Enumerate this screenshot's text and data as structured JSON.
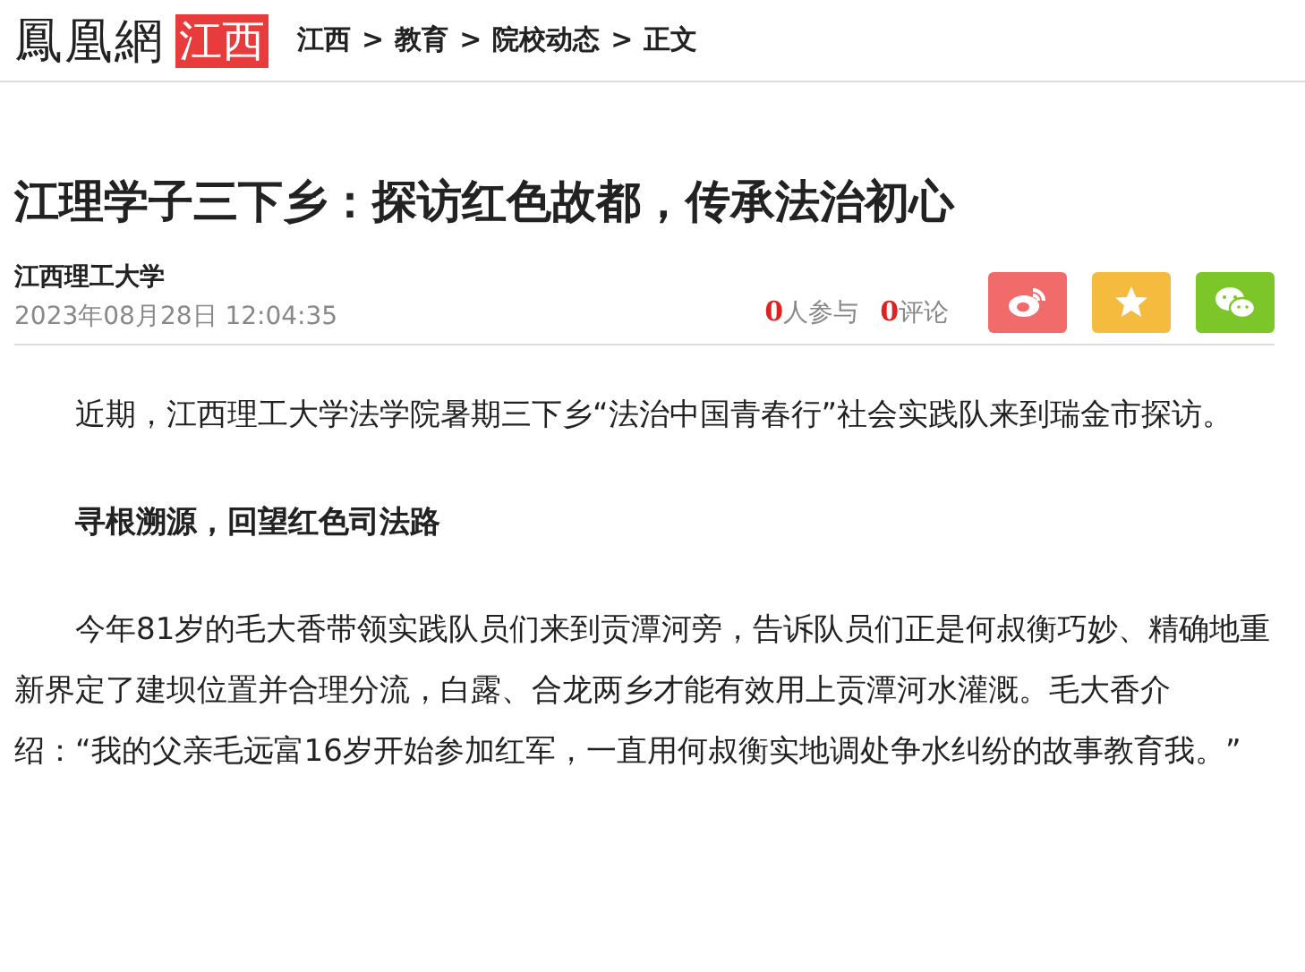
{
  "header": {
    "logo": "鳳凰網",
    "region": "江西",
    "breadcrumb": [
      {
        "label": "江西",
        "separator": ">"
      },
      {
        "label": "教育",
        "separator": ">"
      },
      {
        "label": "院校动态",
        "separator": ">"
      },
      {
        "label": "正文"
      }
    ]
  },
  "article": {
    "title": "江理学子三下乡：探访红色故都，传承法治初心",
    "author": "江西理工大学",
    "date": "2023年08月28日 12:04:35",
    "stats": [
      {
        "count": "0",
        "label": "人参与"
      },
      {
        "count": "0",
        "label": "评论"
      }
    ],
    "share": [
      {
        "kind": "weibo"
      },
      {
        "kind": "favorite"
      },
      {
        "kind": "wechat"
      }
    ],
    "paragraphs": [
      {
        "kind": "text",
        "text": "近期，江西理工大学法学院暑期三下乡“法治中国青春行”社会实践队来到瑞金市探访。"
      },
      {
        "kind": "heading",
        "text": "寻根溯源，回望红色司法路"
      },
      {
        "kind": "text",
        "text": "今年81岁的毛大香带领实践队员们来到贡潭河旁，告诉队员们正是何叔衡巧妙、精确地重新界定了建坝位置并合理分流，白露、合龙两乡才能有效用上贡潭河水灌溉。毛大香介绍：“我的父亲毛远富16岁开始参加红军，一直用何叔衡实地调处争水纠纷的故事教育我。”"
      }
    ]
  }
}
